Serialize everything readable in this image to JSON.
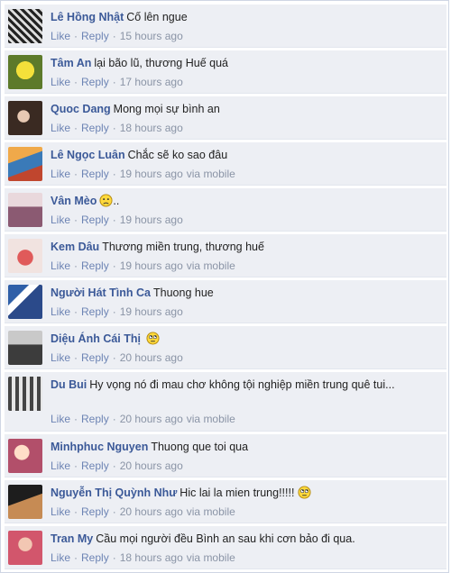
{
  "actions": {
    "like": "Like",
    "reply": "Reply",
    "dot": "·"
  },
  "comments": [
    {
      "name": "Lê Hồng Nhật",
      "text": "Cố lên ngue",
      "time": "15 hours ago",
      "via": "",
      "emoji": "none"
    },
    {
      "name": "Tâm An",
      "text": "lại bão lũ, thương Huế quá",
      "time": "17 hours ago",
      "via": "",
      "emoji": "none"
    },
    {
      "name": "Quoc Dang",
      "text": "Mong mọi sự bình an",
      "time": "18 hours ago",
      "via": "",
      "emoji": "none"
    },
    {
      "name": "Lê Ngọc Luân",
      "text": "Chắc sẽ ko sao đâu",
      "time": "19 hours ago",
      "via": "via mobile",
      "emoji": "none"
    },
    {
      "name": "Vân Mèo",
      "text": "..",
      "time": "19 hours ago",
      "via": "",
      "emoji": "sad"
    },
    {
      "name": "Kem Dâu",
      "text": "Thương miền trung, thương huế",
      "time": "19 hours ago",
      "via": "via mobile",
      "emoji": "none"
    },
    {
      "name": "Người Hát Tình Ca",
      "text": "Thuong hue",
      "time": "19 hours ago",
      "via": "",
      "emoji": "none"
    },
    {
      "name": "Diệu Ánh Cái Thị",
      "text": "",
      "time": "20 hours ago",
      "via": "",
      "emoji": "roll"
    },
    {
      "name": "Du Bui",
      "text": "Hy vọng nó đi mau chơ không tội nghiệp miền trung quê tui...",
      "time": "20 hours ago",
      "via": "via mobile",
      "emoji": "none"
    },
    {
      "name": "Minhphuc Nguyen",
      "text": "Thuong que toi qua",
      "time": "20 hours ago",
      "via": "",
      "emoji": "none"
    },
    {
      "name": "Nguyễn Thị Quỳnh Như",
      "text": "Hic lai la mien trung!!!!!",
      "time": "20 hours ago",
      "via": "via mobile",
      "emoji": "roll"
    },
    {
      "name": "Tran My",
      "text": "Cầu mọi người đều Bình an sau khi cơn bảo đi qua.",
      "time": "18 hours ago",
      "via": "via mobile",
      "emoji": "none"
    }
  ]
}
